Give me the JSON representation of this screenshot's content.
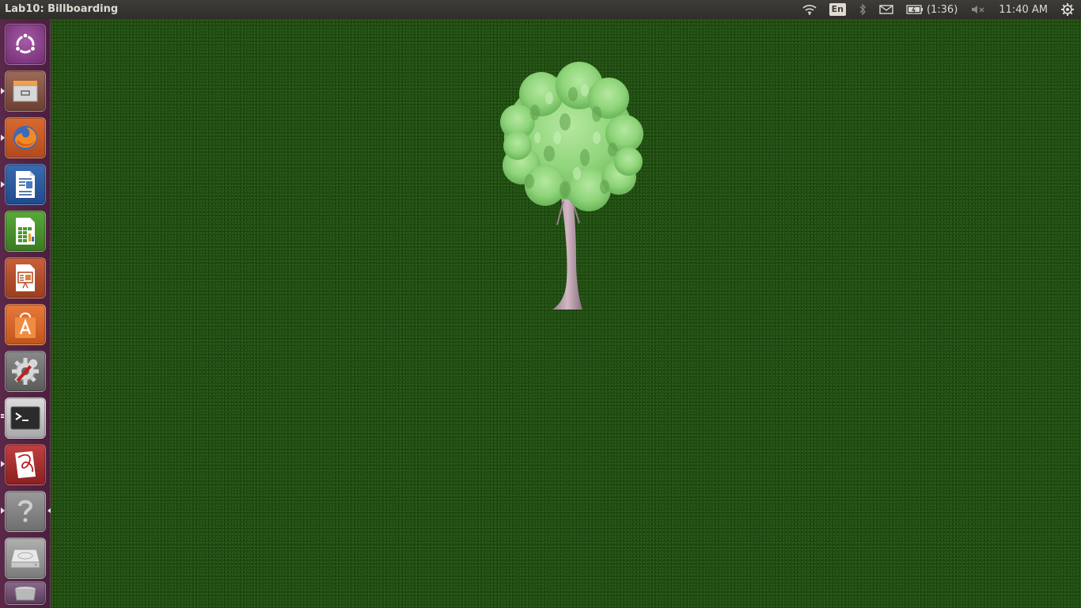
{
  "top_panel": {
    "window_title": "Lab10: Billboarding",
    "keyboard_layout": "En",
    "battery_time": "(1:36)",
    "clock": "11:40 AM"
  },
  "launcher": {
    "items": [
      {
        "name": "dash-home",
        "icon": "ubuntu-logo-icon",
        "color": "#7e3a86"
      },
      {
        "name": "files",
        "icon": "file-cabinet-icon",
        "color": "#8a5a4a"
      },
      {
        "name": "firefox",
        "icon": "firefox-icon",
        "color": "#c4592a"
      },
      {
        "name": "libreoffice-writer",
        "icon": "writer-document-icon",
        "color": "#2f5a9c"
      },
      {
        "name": "libreoffice-calc",
        "icon": "calc-spreadsheet-icon",
        "color": "#4a9a2c"
      },
      {
        "name": "libreoffice-impress",
        "icon": "impress-presentation-icon",
        "color": "#b8502a"
      },
      {
        "name": "software-center",
        "icon": "shopping-bag-icon",
        "color": "#d9652a"
      },
      {
        "name": "system-settings",
        "icon": "gear-wrench-icon",
        "color": "#7a7a7a"
      },
      {
        "name": "terminal",
        "icon": "terminal-icon",
        "color": "#3a3a3a"
      },
      {
        "name": "document-viewer",
        "icon": "pdf-viewer-icon",
        "color": "#b03030"
      },
      {
        "name": "help",
        "icon": "question-icon",
        "color": "#8a8a8a"
      },
      {
        "name": "drive",
        "icon": "hard-drive-icon",
        "color": "#9a9a9a"
      },
      {
        "name": "trash",
        "icon": "trash-icon",
        "color": "#8a7a8a"
      }
    ]
  },
  "scene": {
    "background_color": "#1f4b10",
    "object": "tree-billboard"
  }
}
